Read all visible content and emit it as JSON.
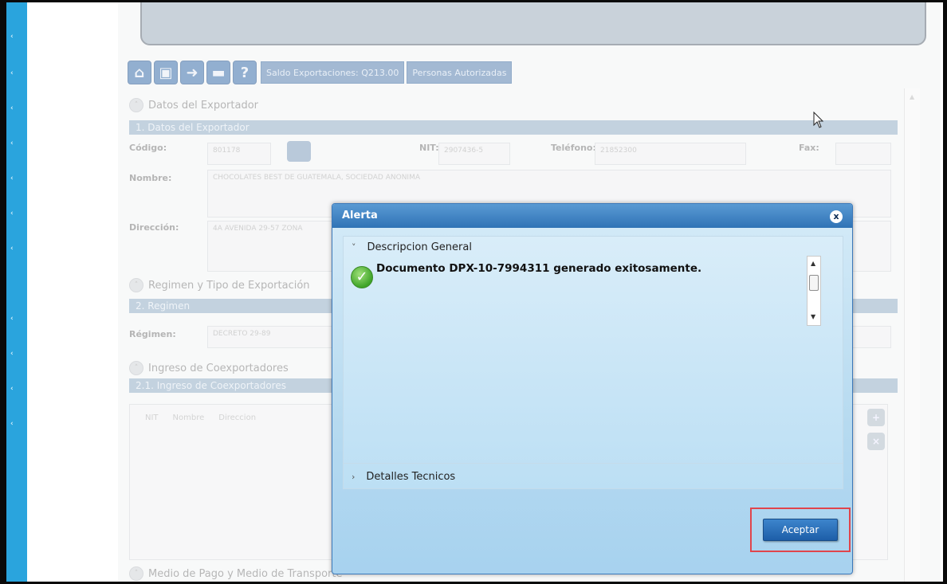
{
  "toolbar": {
    "saldo_label": "Saldo Exportaciones: Q213.00",
    "personas_label": "Personas Autorizadas"
  },
  "sections": {
    "exportador": {
      "title": "Datos del Exportador",
      "bar": "1. Datos del Exportador"
    },
    "regimen": {
      "title": "Regimen y Tipo de  Exportación",
      "bar": "2. Regimen"
    },
    "coexportadores": {
      "title": "Ingreso de Coexportadores",
      "bar": "2.1. Ingreso de Coexportadores"
    },
    "medio_pago": {
      "title": "Medio de Pago y Medio de Transporte"
    }
  },
  "fields": {
    "codigo_label": "Código:",
    "codigo_value": "801178",
    "nit_label": "NIT:",
    "nit_value": "2907436-5",
    "telefono_label": "Teléfono:",
    "telefono_value": "21852300",
    "fax_label": "Fax:",
    "nombre_label": "Nombre:",
    "nombre_value": "CHOCOLATES BEST DE GUATEMALA, SOCIEDAD ANONIMA",
    "direccion_label": "Dirección:",
    "direccion_value": "4A AVENIDA 29-57 ZONA",
    "regimen_label": "Régimen:",
    "regimen_value": "DECRETO 29-89"
  },
  "coexportadores_grid": {
    "columns": [
      "NIT",
      "Nombre",
      "Direccion"
    ]
  },
  "dialog": {
    "title": "Alerta",
    "close_glyph": "x",
    "general_header": "Descripcion General",
    "message": "Documento DPX-10-7994311 generado exitosamente.",
    "technical_header": "Detalles Tecnicos",
    "accept_label": "Aceptar"
  }
}
